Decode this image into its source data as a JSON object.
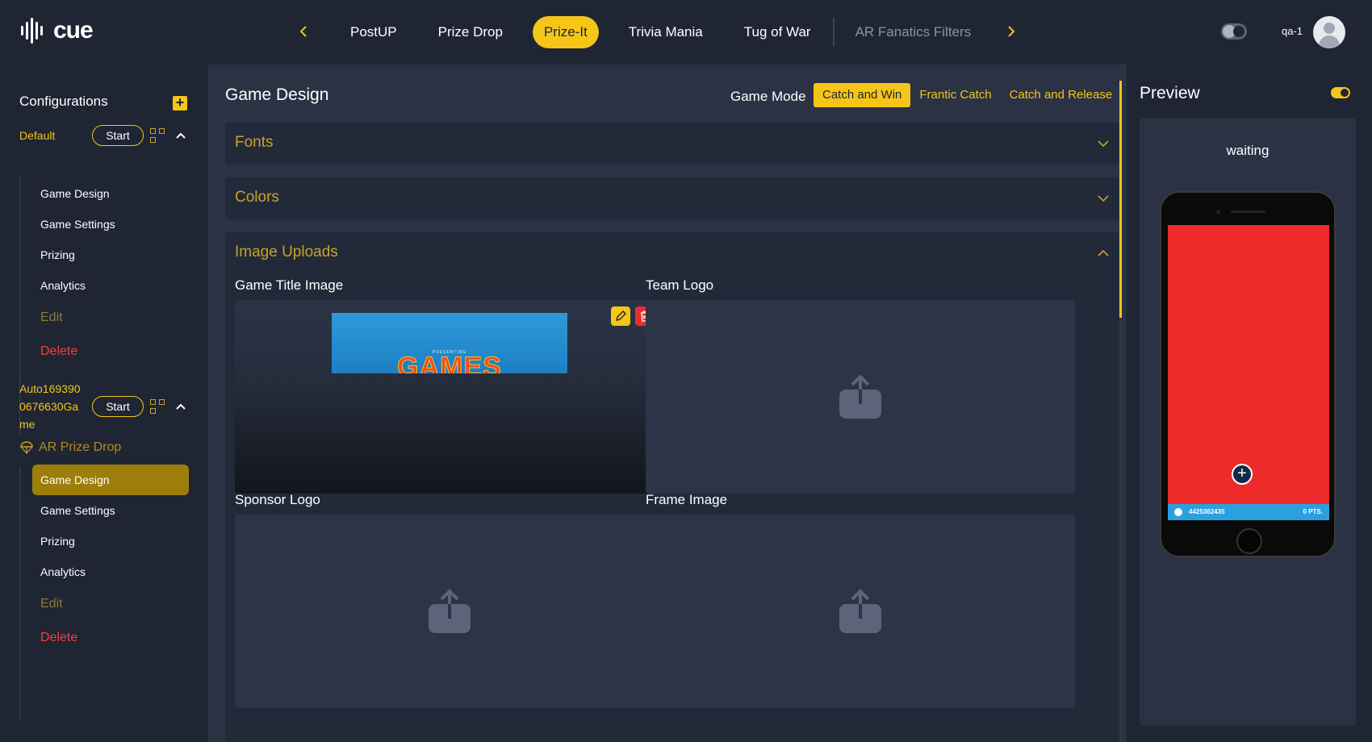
{
  "app": {
    "logo_text": "cue"
  },
  "nav": {
    "tabs": [
      {
        "label": "PostUP",
        "state": "normal"
      },
      {
        "label": "Prize Drop",
        "state": "normal"
      },
      {
        "label": "Prize-It",
        "state": "active"
      },
      {
        "label": "Trivia Mania",
        "state": "normal"
      },
      {
        "label": "Tug of War",
        "state": "normal"
      },
      {
        "label": "AR Fanatics Filters",
        "state": "muted"
      }
    ]
  },
  "user": {
    "name": "qa-1"
  },
  "sidebar": {
    "title": "Configurations",
    "configs": [
      {
        "name": "Default",
        "start_label": "Start",
        "items": [
          "Game Design",
          "Game Settings",
          "Prizing",
          "Analytics"
        ],
        "edit_label": "Edit",
        "delete_label": "Delete"
      },
      {
        "name_lines": [
          "Auto169390",
          "0676630Ga",
          "me"
        ],
        "start_label": "Start",
        "game_type": "AR Prize Drop",
        "items": [
          "Game Design",
          "Game Settings",
          "Prizing",
          "Analytics"
        ],
        "active_item": "Game Design",
        "edit_label": "Edit",
        "delete_label": "Delete"
      }
    ]
  },
  "main": {
    "title": "Game Design",
    "game_mode": {
      "label": "Game Mode",
      "options": [
        "Catch and Win",
        "Frantic Catch",
        "Catch and Release"
      ],
      "selected": "Catch and Win"
    },
    "sections": {
      "fonts": "Fonts",
      "colors": "Colors",
      "image_uploads": "Image Uploads"
    },
    "uploads": {
      "game_title_image": "Game Title Image",
      "team_logo": "Team Logo",
      "sponsor_logo": "Sponsor Logo",
      "frame_image": "Frame Image"
    },
    "title_image_preview": {
      "small_text": "PRESENTING",
      "big_text": "GAMES"
    }
  },
  "preview": {
    "title": "Preview",
    "status": "waiting",
    "phone": {
      "bar_text": "4425362435",
      "points_text": "0 PTS.",
      "screen_color": "#ee2a2a"
    }
  },
  "colors": {
    "accent": "#f5c518",
    "danger": "#e43030",
    "background": "#1f2533",
    "panel": "#2a3244"
  }
}
